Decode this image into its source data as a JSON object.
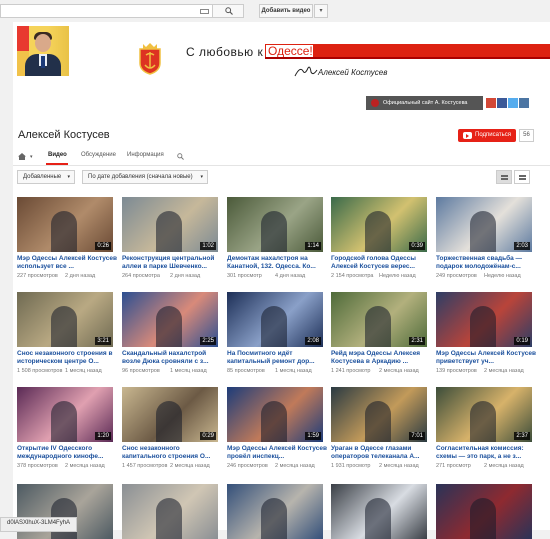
{
  "masthead": {
    "search_placeholder": "",
    "upload_label": "Добавить видео",
    "upload_caret": "▾"
  },
  "banner": {
    "tagline": "С любовью к",
    "city": "Одессе!",
    "signature_name": "Алексей Костусев",
    "site_link": "Официальный сайт А. Костусева"
  },
  "channel": {
    "name": "Алексей Костусев",
    "subscribe_label": "Подписаться",
    "subscriber_count": "56",
    "tabs": [
      {
        "label": "Видео",
        "active": true
      },
      {
        "label": "Обсуждение",
        "active": false
      },
      {
        "label": "Информация",
        "active": false
      }
    ]
  },
  "filters": {
    "type_dropdown": "Добавленные",
    "sort_dropdown": "По дате добавления (сначала новые)"
  },
  "videos": [
    {
      "title": "Мэр Одессы Алексей Костусев использует все ...",
      "views": "227 просмотров",
      "date": "2 дня назад",
      "duration": "0:26"
    },
    {
      "title": "Реконструкция центральной аллеи в парке Шевченко...",
      "views": "264 просмотра",
      "date": "2 дня назад",
      "duration": "1:02"
    },
    {
      "title": "Демонтаж нахалстроя на Канатной, 132. Одесса. Ко...",
      "views": "301 просмотр",
      "date": "4 дня назад",
      "duration": "1:14"
    },
    {
      "title": "Городской голова Одессы Алексей Костусев верес...",
      "views": "2 154 просмотра",
      "date": "Неделю назад",
      "duration": "0:39"
    },
    {
      "title": "Торжественная свадьба — подарок молодожёнам-с...",
      "views": "249 просмотров",
      "date": "Неделю назад",
      "duration": "2:03"
    },
    {
      "title": "Снос незаконного строения в историческом центре О...",
      "views": "1 508 просмотров",
      "date": "1 месяц назад",
      "duration": "3:21"
    },
    {
      "title": "Скандальный нахалстрой возле Дюка сровняли с з...",
      "views": "96 просмотров",
      "date": "1 месяц назад",
      "duration": "2:25"
    },
    {
      "title": "На Посмитного идёт капитальный ремонт дор...",
      "views": "85 просмотров",
      "date": "1 месяц назад",
      "duration": "2:08"
    },
    {
      "title": "Рейд мэра Одессы Алексея Костусева в Аркадию ...",
      "views": "1 241 просмотр",
      "date": "2 месяца назад",
      "duration": "2:31"
    },
    {
      "title": "Мэр Одессы Алексей Костусев приветствует уч...",
      "views": "139 просмотров",
      "date": "2 месяца назад",
      "duration": "0:19"
    },
    {
      "title": "Открытие IV Одесского международного кинофе...",
      "views": "378 просмотров",
      "date": "2 месяца назад",
      "duration": "1:20"
    },
    {
      "title": "Снос незаконного капитального строения О...",
      "views": "1 457 просмотров",
      "date": "2 месяца назад",
      "duration": "0:29"
    },
    {
      "title": "Мэр Одессы Алексей Костусев провёл инспекц...",
      "views": "246 просмотров",
      "date": "2 месяца назад",
      "duration": "1:59"
    },
    {
      "title": "Ураган в Одессе глазами операторов телеканала А...",
      "views": "1 931 просмотр",
      "date": "2 месяца назад",
      "duration": "7:01"
    },
    {
      "title": "Согласительная комиссия: схемы — это парк, а не з...",
      "views": "271 просмотр",
      "date": "2 месяца назад",
      "duration": "2:37"
    },
    {
      "title": "",
      "views": "",
      "date": "",
      "duration": ""
    },
    {
      "title": "",
      "views": "",
      "date": "",
      "duration": ""
    },
    {
      "title": "",
      "views": "",
      "date": "",
      "duration": ""
    },
    {
      "title": "",
      "views": "",
      "date": "",
      "duration": ""
    },
    {
      "title": "",
      "views": "",
      "date": "",
      "duration": ""
    }
  ],
  "status_bar": {
    "url": "d0lASXlhuX-3LM4FyhA"
  },
  "colors": {
    "accent": "#e62117",
    "link": "#1a4f9c",
    "banner_red": "#dd1111"
  }
}
